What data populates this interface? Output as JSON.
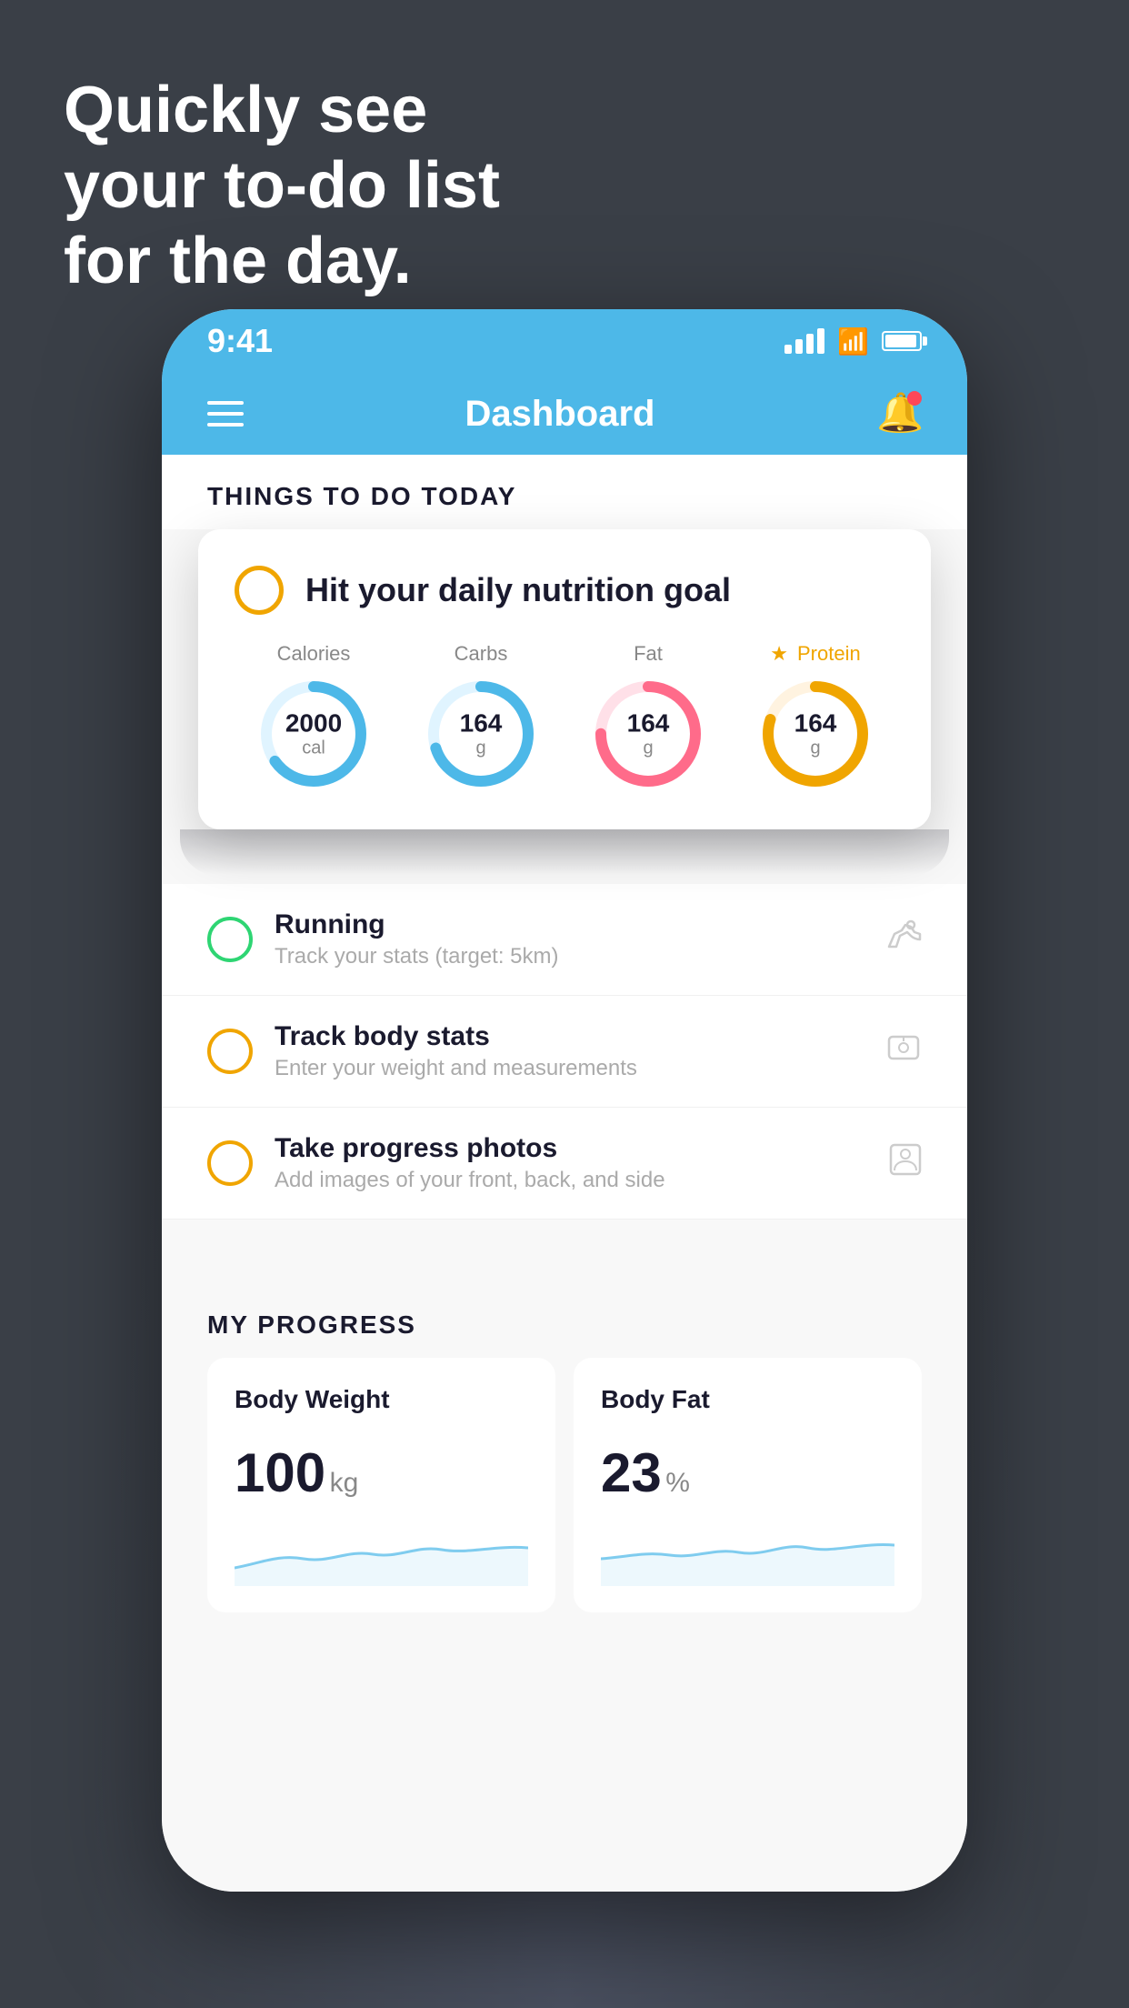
{
  "hero": {
    "line1": "Quickly see",
    "line2": "your to-do list",
    "line3": "for the day."
  },
  "phone": {
    "statusBar": {
      "time": "9:41"
    },
    "navBar": {
      "title": "Dashboard"
    },
    "sections": {
      "todo": {
        "heading": "THINGS TO DO TODAY"
      },
      "progress": {
        "heading": "MY PROGRESS"
      }
    },
    "nutritionCard": {
      "title": "Hit your daily nutrition goal",
      "items": [
        {
          "label": "Calories",
          "value": "2000",
          "unit": "cal",
          "color": "#4db8e8",
          "trackColor": "#e0f4ff",
          "percent": 65
        },
        {
          "label": "Carbs",
          "value": "164",
          "unit": "g",
          "color": "#4db8e8",
          "trackColor": "#e0f4ff",
          "percent": 70
        },
        {
          "label": "Fat",
          "value": "164",
          "unit": "g",
          "color": "#ff6b8a",
          "trackColor": "#ffe0e8",
          "percent": 75
        },
        {
          "label": "Protein",
          "value": "164",
          "unit": "g",
          "color": "#f0a500",
          "trackColor": "#fff3e0",
          "percent": 80,
          "starred": true
        }
      ]
    },
    "todoItems": [
      {
        "title": "Running",
        "subtitle": "Track your stats (target: 5km)",
        "circleColor": "green",
        "icon": "shoe"
      },
      {
        "title": "Track body stats",
        "subtitle": "Enter your weight and measurements",
        "circleColor": "yellow",
        "icon": "scale"
      },
      {
        "title": "Take progress photos",
        "subtitle": "Add images of your front, back, and side",
        "circleColor": "yellow",
        "icon": "person"
      }
    ],
    "progressCards": [
      {
        "title": "Body Weight",
        "value": "100",
        "unit": "kg"
      },
      {
        "title": "Body Fat",
        "value": "23",
        "unit": "%"
      }
    ]
  },
  "colors": {
    "background": "#3a3f47",
    "phoneHeader": "#4db8e8",
    "white": "#ffffff",
    "textDark": "#1a1a2e",
    "textGray": "#888888",
    "yellow": "#f0a500",
    "green": "#2ed573",
    "red": "#ff4757",
    "blue": "#4db8e8"
  }
}
